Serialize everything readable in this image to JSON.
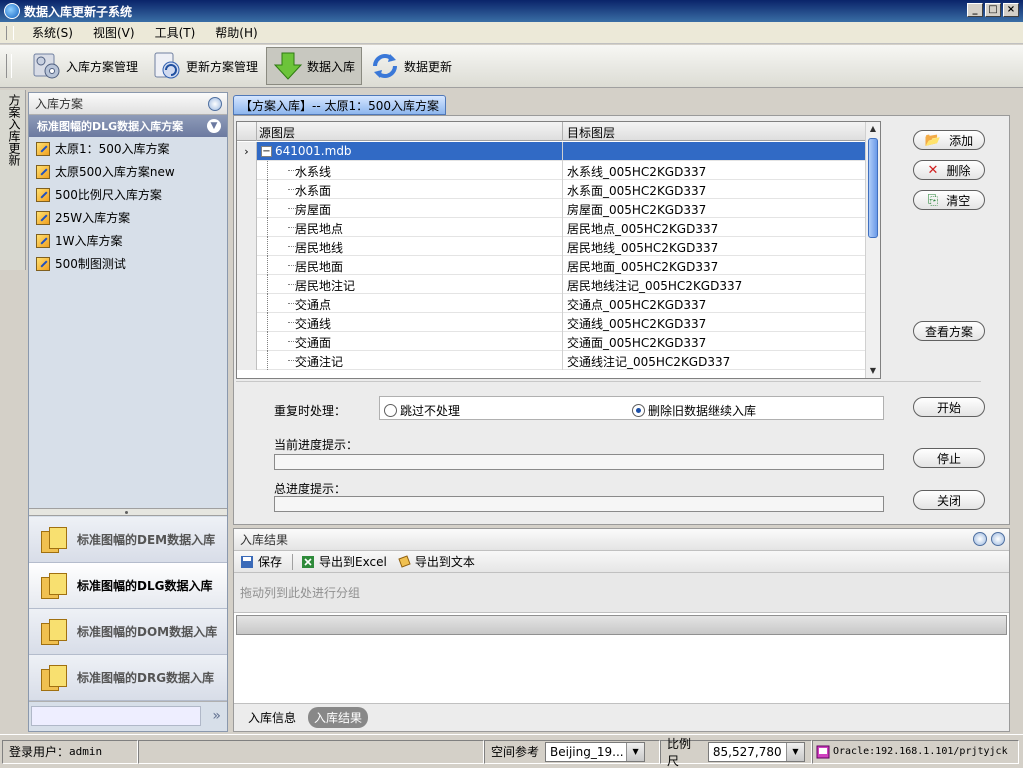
{
  "window": {
    "title": "数据入库更新子系统"
  },
  "menu": {
    "items": [
      "系统(S)",
      "视图(V)",
      "工具(T)",
      "帮助(H)"
    ]
  },
  "toolbar": {
    "buttons": [
      "入库方案管理",
      "更新方案管理",
      "数据入库",
      "数据更新"
    ],
    "active_index": 2
  },
  "vertical_tab": {
    "label": "方案入库更新"
  },
  "left_panel": {
    "title": "入库方案",
    "group_title": "标准图幅的DLG数据入库方案",
    "items": [
      "太原1：500入库方案",
      "太原500入库方案new",
      "500比例尺入库方案",
      "25W入库方案",
      "1W入库方案",
      "500制图测试"
    ],
    "nav": [
      "标准图幅的DEM数据入库",
      "标准图幅的DLG数据入库",
      "标准图幅的DOM数据入库",
      "标准图幅的DRG数据入库"
    ],
    "nav_selected": 1,
    "more_glyph": "»"
  },
  "doc_tab": {
    "label": "【方案入库】-- 太原1：500入库方案"
  },
  "grid": {
    "headers": [
      "源图层",
      "目标图层"
    ],
    "root": "641001.mdb",
    "rows": [
      [
        "水系线",
        "水系线_005HC2KGD337"
      ],
      [
        "水系面",
        "水系面_005HC2KGD337"
      ],
      [
        "房屋面",
        "房屋面_005HC2KGD337"
      ],
      [
        "居民地点",
        "居民地点_005HC2KGD337"
      ],
      [
        "居民地线",
        "居民地线_005HC2KGD337"
      ],
      [
        "居民地面",
        "居民地面_005HC2KGD337"
      ],
      [
        "居民地注记",
        "居民地线注记_005HC2KGD337"
      ],
      [
        "交通点",
        "交通点_005HC2KGD337"
      ],
      [
        "交通线",
        "交通线_005HC2KGD337"
      ],
      [
        "交通面",
        "交通面_005HC2KGD337"
      ],
      [
        "交通注记",
        "交通线注记_005HC2KGD337"
      ]
    ]
  },
  "side_buttons": {
    "add": "添加",
    "delete": "删除",
    "clear": "清空",
    "view": "查看方案",
    "start": "开始",
    "stop": "停止",
    "close": "关闭"
  },
  "options": {
    "duplicate_label": "重复时处理：",
    "skip_label": "跳过不处理",
    "delete_label": "删除旧数据继续入库",
    "selected": "delete",
    "current_progress_label": "当前进度提示：",
    "total_progress_label": "总进度提示：",
    "current_progress": 0,
    "total_progress": 0
  },
  "results": {
    "title": "入库结果",
    "tools": [
      "保存",
      "导出到Excel",
      "导出到文本"
    ],
    "group_hint": "拖动列到此处进行分组",
    "tabs": [
      "入库信息",
      "入库结果"
    ],
    "active_tab": 1
  },
  "status": {
    "user_label": "登录用户：",
    "user": "admin",
    "spatial_label": "空间参考",
    "spatial_value": "Beijing_19...",
    "scale_label": "比例尺",
    "scale_value": "85,527,780",
    "db": "Oracle:192.168.1.101/prjtyjck"
  }
}
